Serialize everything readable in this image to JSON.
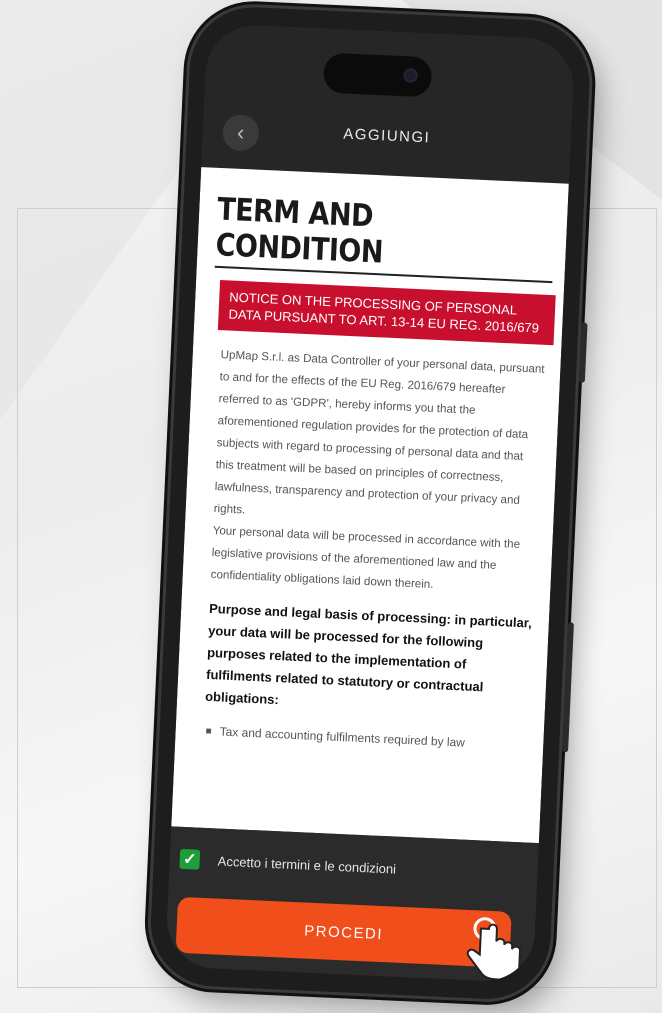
{
  "appbar": {
    "title": "AGGIUNGI",
    "back_icon": "chevron-left-icon"
  },
  "document": {
    "title": "TERM AND CONDITION",
    "notice": "NOTICE ON THE PROCESSING OF PERSONAL DATA PURSUANT TO ART. 13-14 EU REG. 2016/679",
    "paragraph1": "UpMap S.r.l. as Data Controller of your personal data, pursuant to and for the effects of the EU Reg. 2016/679 hereafter referred to as 'GDPR', hereby informs you that the aforementioned regulation provides for the protection of data subjects with regard to processing of personal data and that this treatment will be based on principles of correctness, lawfulness, transparency and protection of your privacy and rights.",
    "paragraph2": "Your personal data will be processed in accordance with the legislative provisions of the aforementioned law and the confidentiality obligations laid down therein.",
    "purpose_heading": "Purpose and legal basis of processing: in particular, your data will be processed for the following purposes related to the implementation of fulfilments related to statutory or contractual obligations:",
    "bullets": [
      "Tax and accounting fulfilments required by law"
    ]
  },
  "footer": {
    "accept_label": "Accetto i termini e le condizioni",
    "accept_checked": true,
    "proceed_label": "PROCEDI"
  },
  "colors": {
    "notice_bg": "#c8102e",
    "proceed_bg": "#f04e1a",
    "checkbox_bg": "#1f9d3a"
  }
}
